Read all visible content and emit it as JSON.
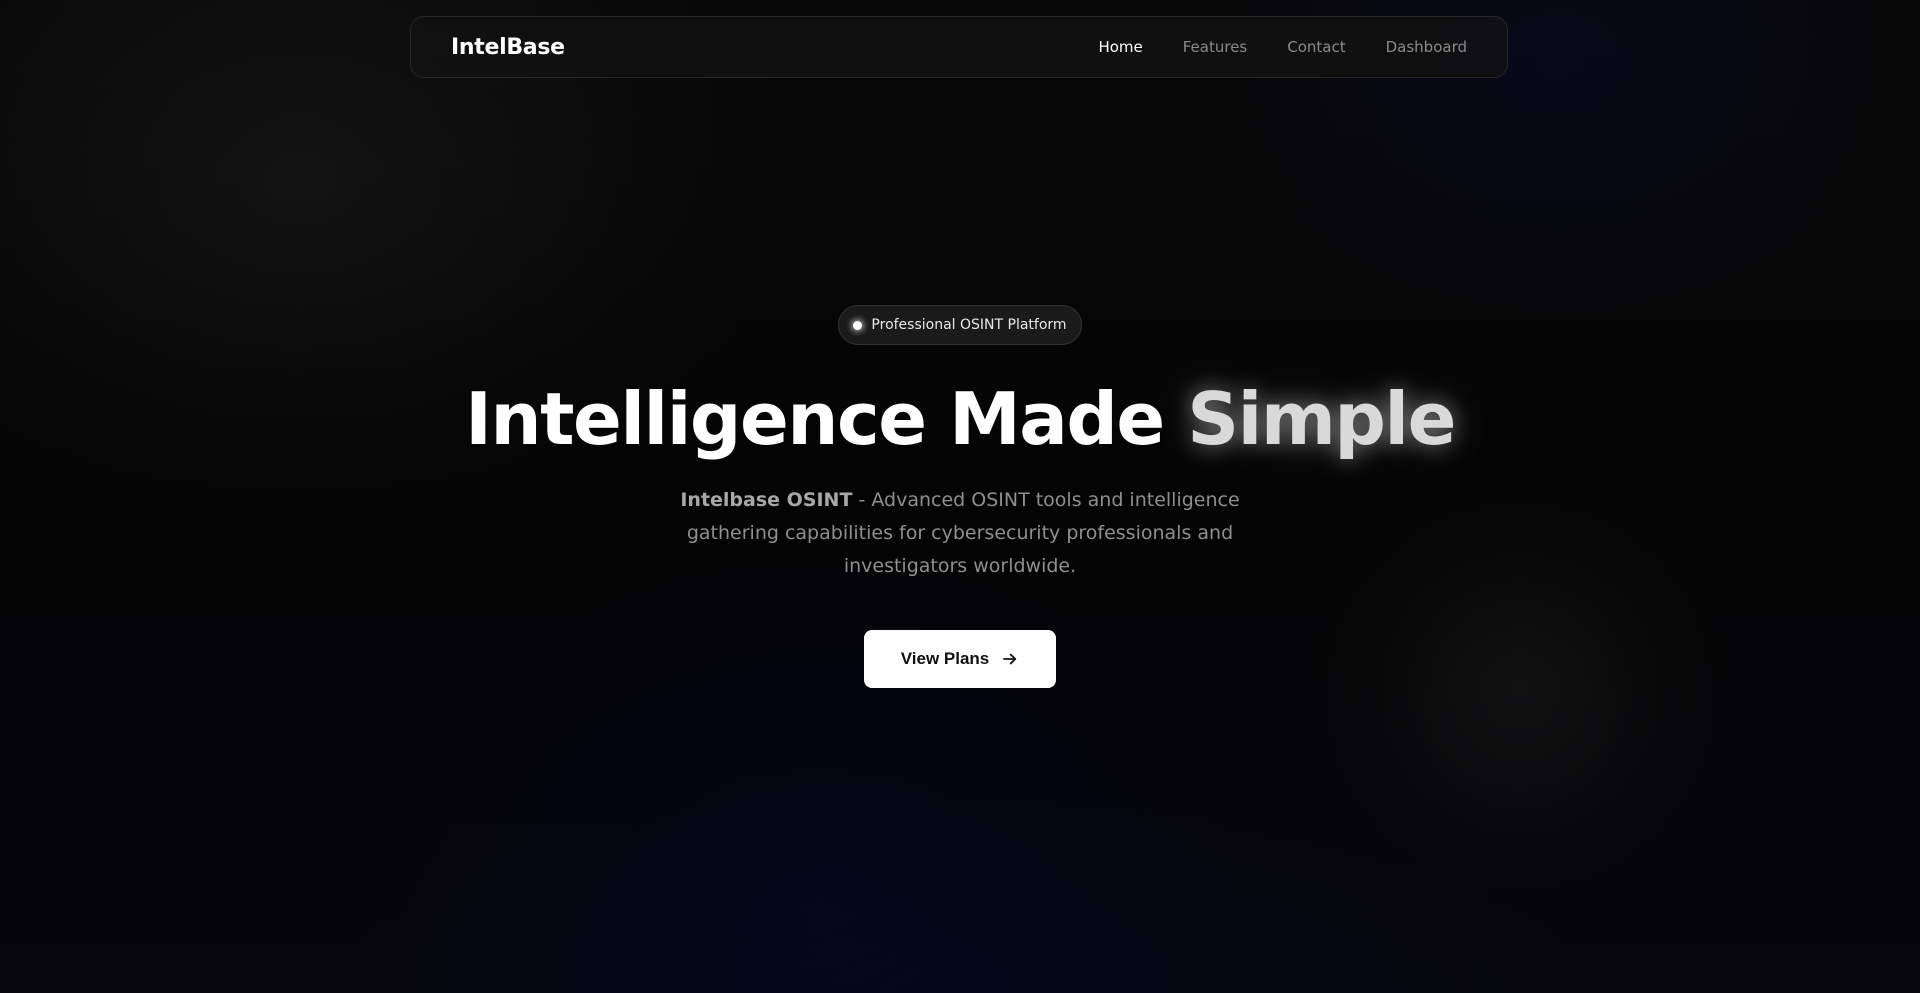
{
  "navbar": {
    "brand": "IntelBase",
    "links": [
      {
        "label": "Home",
        "active": true
      },
      {
        "label": "Features",
        "active": false
      },
      {
        "label": "Contact",
        "active": false
      },
      {
        "label": "Dashboard",
        "active": false
      }
    ]
  },
  "hero": {
    "badge": {
      "label": "Professional OSINT Platform"
    },
    "headline": {
      "main": "Intelligence Made ",
      "highlight": "Simple"
    },
    "subtitle": {
      "strong": "Intelbase OSINT",
      "line1": " - Advanced OSINT tools and intelligence",
      "line2": "gathering capabilities for cybersecurity professionals and",
      "line3": "investigators worldwide."
    },
    "cta": {
      "label": "View Plans",
      "icon": "arrow-right-icon"
    }
  },
  "colors": {
    "background": "#050505",
    "nav_border": "#262626",
    "accent": "#ffffff",
    "muted_text": "#8f8f8f"
  }
}
